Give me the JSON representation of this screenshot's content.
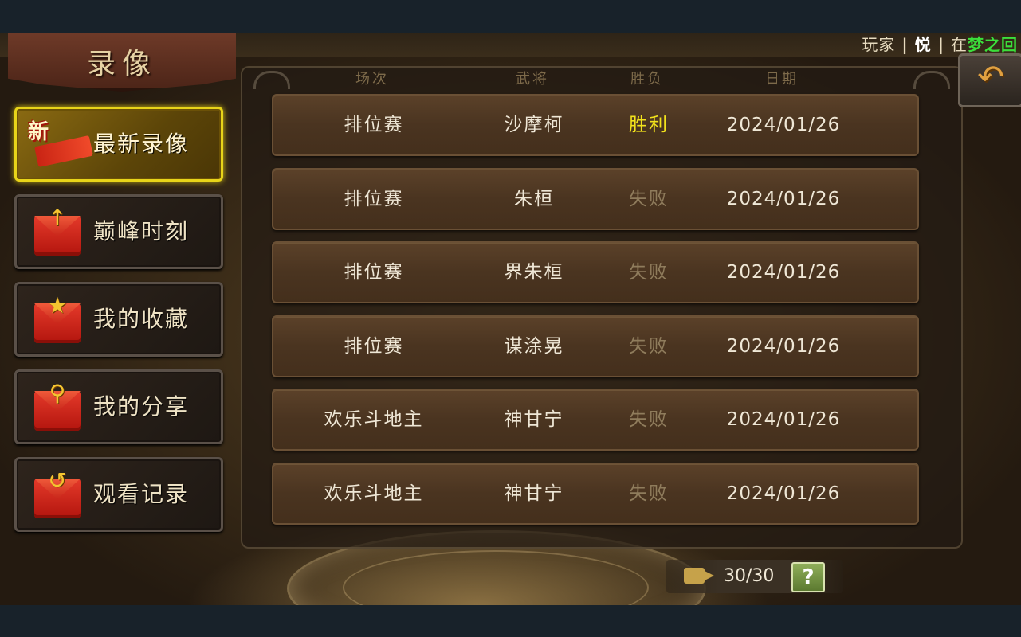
{
  "header": {
    "player_label": "玩家",
    "player_name": "悦",
    "location_prefix": "在",
    "location_name": "梦之回"
  },
  "title": "录像",
  "sidebar": {
    "items": [
      {
        "label": "最新录像",
        "icon": "new-icon",
        "badge": "新",
        "active": true
      },
      {
        "label": "巅峰时刻",
        "icon": "peak-moment-icon",
        "active": false
      },
      {
        "label": "我的收藏",
        "icon": "star-icon",
        "active": false
      },
      {
        "label": "我的分享",
        "icon": "share-icon",
        "active": false
      },
      {
        "label": "观看记录",
        "icon": "history-icon",
        "active": false
      }
    ]
  },
  "table": {
    "columns": [
      "场次",
      "武将",
      "胜负",
      "日期"
    ],
    "rows": [
      {
        "mode": "排位赛",
        "hero": "沙摩柯",
        "result": "胜利",
        "date": "2024/01/26"
      },
      {
        "mode": "排位赛",
        "hero": "朱桓",
        "result": "失败",
        "date": "2024/01/26"
      },
      {
        "mode": "排位赛",
        "hero": "界朱桓",
        "result": "失败",
        "date": "2024/01/26"
      },
      {
        "mode": "排位赛",
        "hero": "谋涂晃",
        "result": "失败",
        "date": "2024/01/26"
      },
      {
        "mode": "欢乐斗地主",
        "hero": "神甘宁",
        "result": "失败",
        "date": "2024/01/26"
      },
      {
        "mode": "欢乐斗地主",
        "hero": "神甘宁",
        "result": "失败",
        "date": "2024/01/26"
      }
    ]
  },
  "footer": {
    "count": "30/30",
    "camera_icon": "video-camera-icon",
    "help_label": "?"
  },
  "colors": {
    "win": "#f2e21c",
    "loss": "#8f7c5c",
    "active_border": "#e8d419",
    "location_green": "#3be03b"
  }
}
